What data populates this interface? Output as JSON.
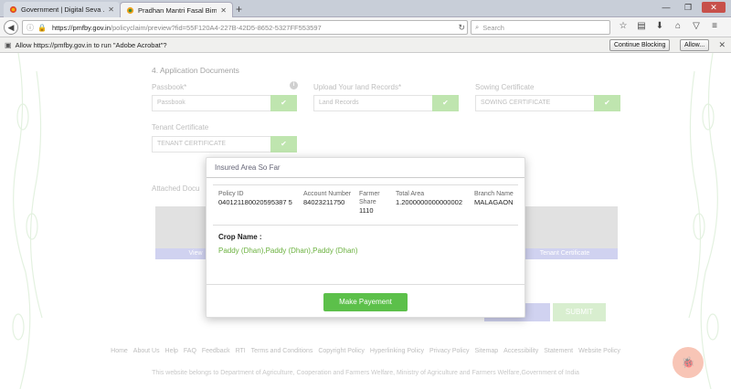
{
  "browser": {
    "tabs": [
      {
        "label": "Government | Digital Seva ...",
        "active": false
      },
      {
        "label": "Pradhan Mantri Fasal Bima...",
        "active": true
      }
    ],
    "new_tab": "+",
    "url_host": "https://pmfby.gov.in",
    "url_path": "/policyclaim/preview?fid=55F120A4-227B-42D5-8652-5327FF553597",
    "search_placeholder": "Search",
    "window_buttons": {
      "minimize": "—",
      "maximize": "❐",
      "close": "✕"
    }
  },
  "notification": {
    "message": "Allow https://pmfby.gov.in to run \"Adobe Acrobat\"?",
    "continue_blocking": "Continue Blocking",
    "allow": "Allow...",
    "close": "✕"
  },
  "form": {
    "section_title": "4. Application Documents",
    "passbook": {
      "label": "Passbook*",
      "value": "Passbook"
    },
    "land_records": {
      "label": "Upload Your land Records*",
      "value": "Land Records"
    },
    "sowing": {
      "label": "Sowing Certificate",
      "value": "SOWING CERTIFICATE"
    },
    "tenant": {
      "label": "Tenant Certificate",
      "value": "TENANT CERTIFICATE"
    },
    "check_glyph": "✔",
    "info_glyph": "i",
    "attached_label": "Attached Docu",
    "doc_labels": {
      "view": "View",
      "tenant": "Tenant Certificate"
    },
    "submit": "SUBMIT"
  },
  "footer": {
    "links": [
      "Home",
      "About Us",
      "Help",
      "FAQ",
      "Feedback",
      "RTI",
      "Terms and Conditions",
      "Copyright Policy",
      "Hyperlinking Policy",
      "Privacy Policy",
      "Sitemap",
      "Accessibility",
      "Statement",
      "Website Policy"
    ],
    "copyright": "This website belongs to Department of Agriculture, Cooperation and Farmers Welfare, Ministry of Agriculture and Farmers Welfare,Government of India"
  },
  "modal": {
    "title": "Insured Area So Far",
    "columns": {
      "policy_id": {
        "header": "Policy ID",
        "value": "040121180020595387 5"
      },
      "account": {
        "header": "Account Number",
        "value": "84023211750"
      },
      "farmer_share": {
        "header": "Farmer Share",
        "value": "1110"
      },
      "total_area": {
        "header": "Total Area",
        "value": "1.2000000000000002"
      },
      "branch": {
        "header": "Branch Name",
        "value": "MALAGAON"
      }
    },
    "crop_label": "Crop Name :",
    "crop_value": "Paddy (Dhan),Paddy (Dhan),Paddy (Dhan)",
    "pay_button": "Make Payement"
  },
  "colors": {
    "accent_green": "#5cc04a",
    "check_green": "#8bcf6e",
    "crop_text_green": "#6bb13f",
    "doc_label_purple": "#aaaee3",
    "fab": "#f3957a"
  }
}
